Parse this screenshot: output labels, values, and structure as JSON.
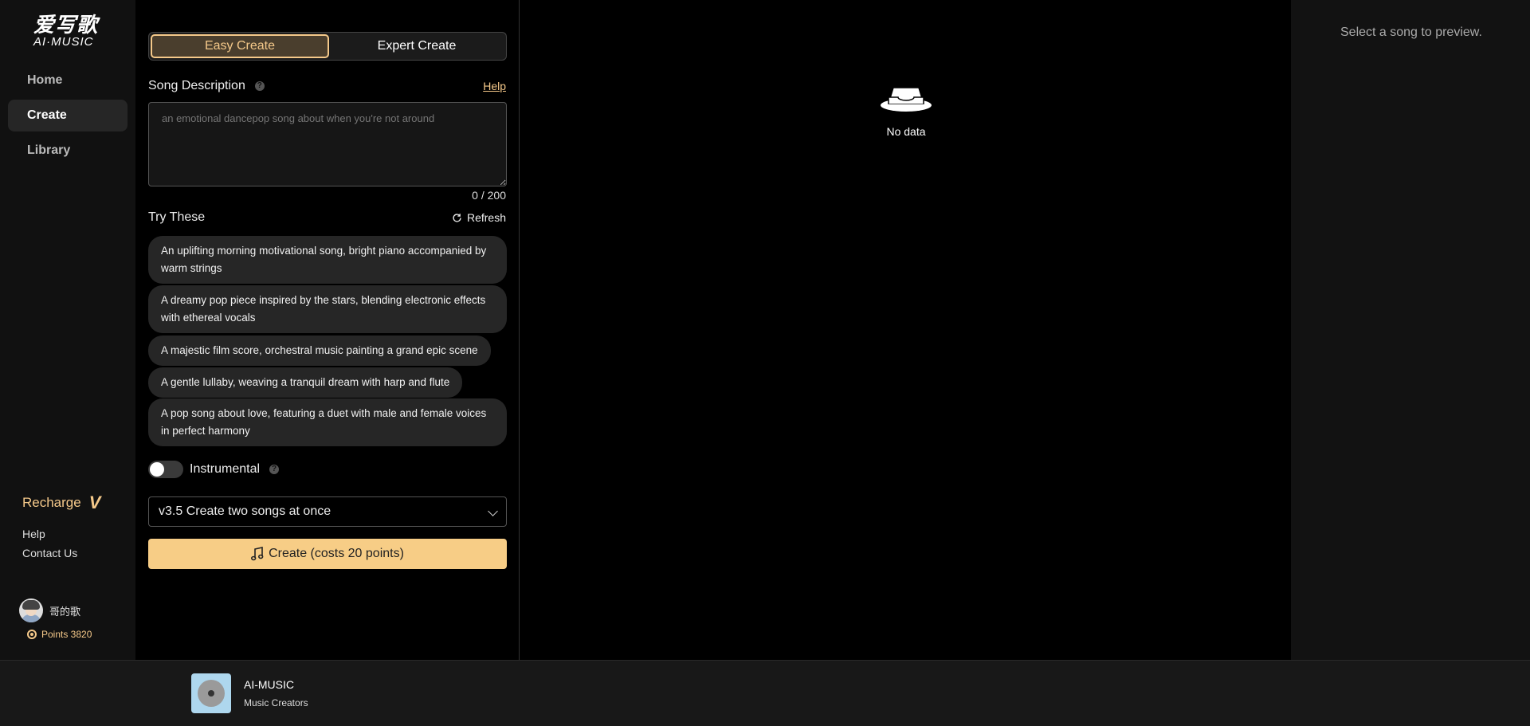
{
  "logo": {
    "cn": "爱写歌",
    "en": "AI·MUSIC"
  },
  "sidebar": {
    "items": [
      {
        "label": "Home",
        "active": false
      },
      {
        "label": "Create",
        "active": true
      },
      {
        "label": "Library",
        "active": false
      }
    ],
    "recharge_label": "Recharge",
    "recharge_badge": "V",
    "help_label": "Help",
    "contact_label": "Contact Us",
    "user": {
      "name": "哥的歌",
      "points_label": "Points 3820"
    }
  },
  "create": {
    "modes": {
      "easy": "Easy Create",
      "expert": "Expert Create",
      "active": "easy"
    },
    "description_label": "Song Description",
    "help_link": "Help",
    "description_value": "",
    "description_placeholder": "an emotional dancepop song about when you're not around",
    "counter": "0 / 200",
    "try_label": "Try These",
    "refresh_label": "Refresh",
    "suggestions": [
      "An uplifting morning motivational song, bright piano accompanied by warm strings",
      "A dreamy pop piece inspired by the stars, blending electronic effects with ethereal vocals",
      "A majestic film score, orchestral music painting a grand epic scene",
      "A gentle lullaby, weaving a tranquil dream with harp and flute",
      "A pop song about love, featuring a duet with male and female voices in perfect harmony"
    ],
    "instrumental_label": "Instrumental",
    "instrumental_on": false,
    "model_select": "v3.5 Create two songs at once",
    "create_button": "Create (costs 20 points)"
  },
  "main": {
    "empty_text": "No data"
  },
  "preview": {
    "text": "Select a song to preview."
  },
  "player": {
    "title": "AI-MUSIC",
    "subtitle": "Music Creators"
  },
  "colors": {
    "accent": "#f7cd86",
    "background": "#000000",
    "sidebar": "#111111"
  }
}
